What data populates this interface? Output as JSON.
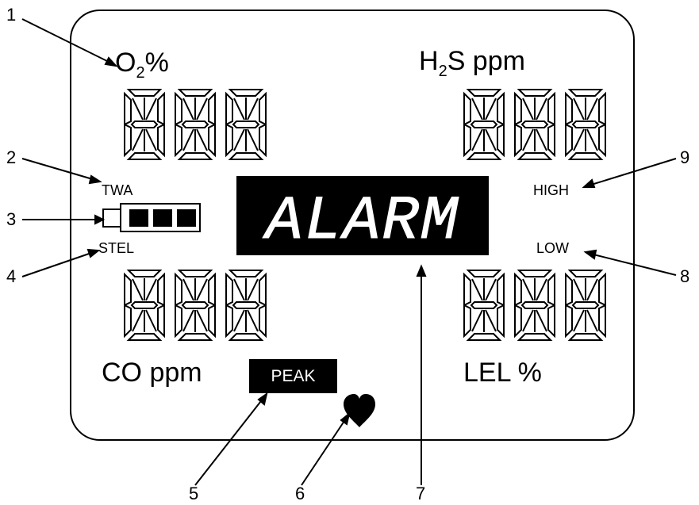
{
  "labels": {
    "o2_prefix": "O",
    "o2_sub": "2",
    "o2_suffix": "%",
    "h2s_prefix": "H",
    "h2s_sub": "2",
    "h2s_suffix": "S ppm",
    "co": "CO ppm",
    "lel": "LEL %",
    "twa": "TWA",
    "stel": "STEL",
    "high": "HIGH",
    "low": "LOW",
    "peak": "PEAK",
    "alarm": "ALARM"
  },
  "callouts": [
    "1",
    "2",
    "3",
    "4",
    "5",
    "6",
    "7",
    "8",
    "9"
  ],
  "battery_level": 3,
  "colors": {
    "ink": "#000000",
    "paper": "#ffffff"
  },
  "icons": [
    "heart-icon",
    "battery-icon"
  ]
}
